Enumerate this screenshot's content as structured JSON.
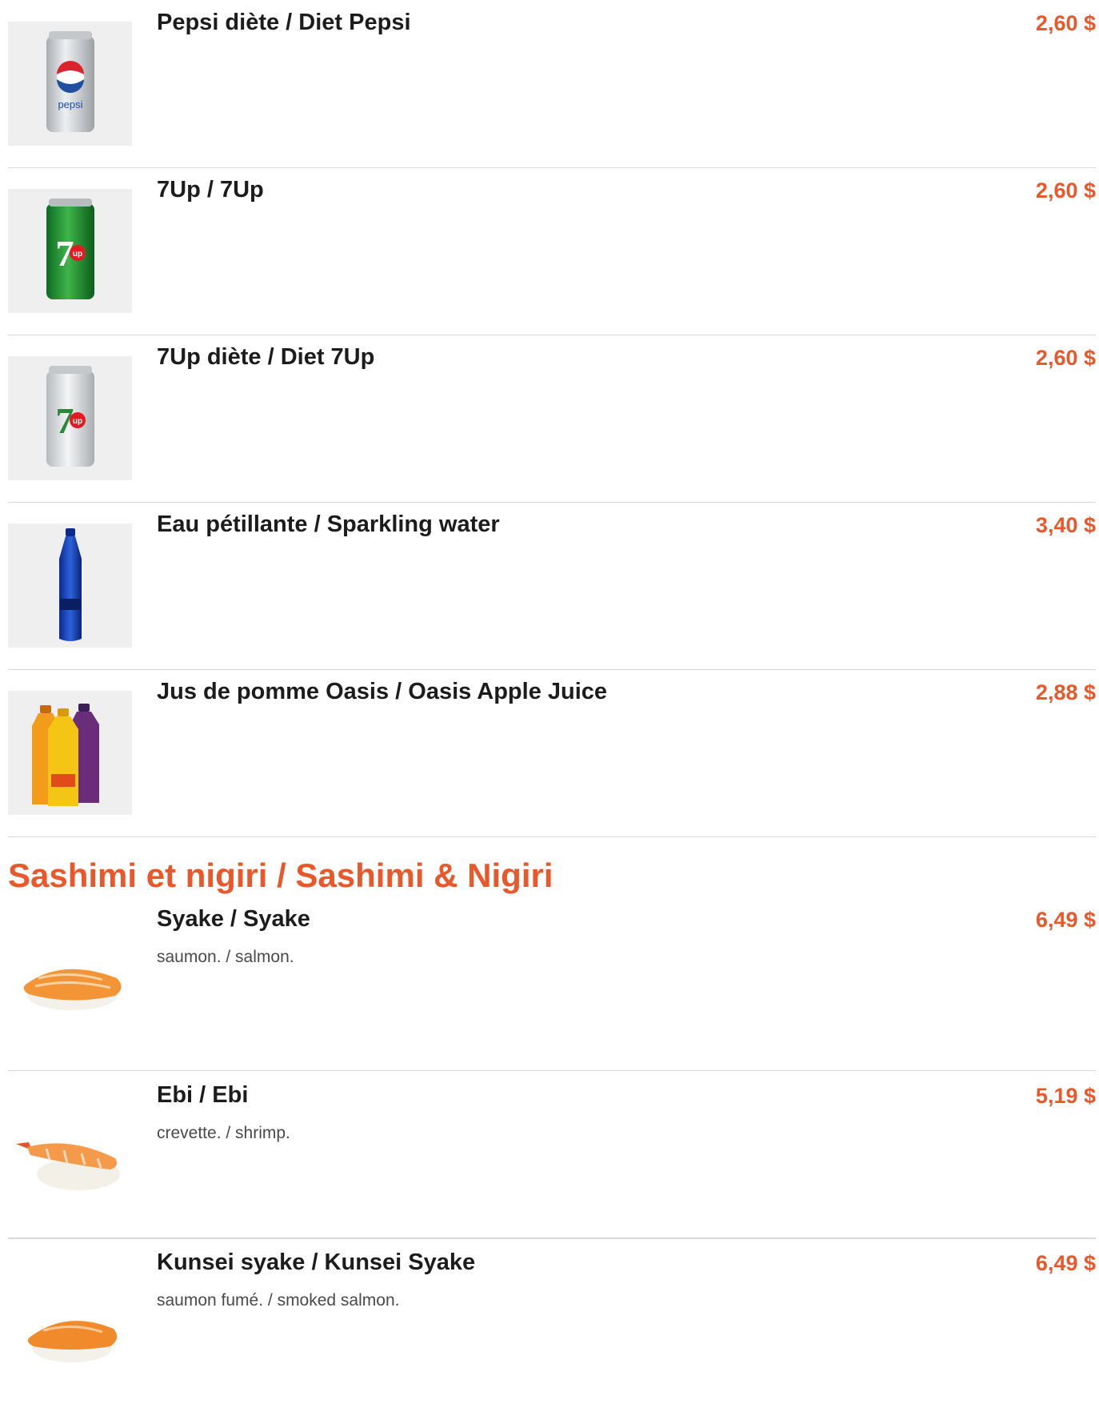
{
  "accent_color": "#e8582a",
  "drinks": [
    {
      "name": "Pepsi diète / Diet Pepsi",
      "price": "2,60 $",
      "icon": "diet-pepsi-can-icon"
    },
    {
      "name": "7Up / 7Up",
      "price": "2,60 $",
      "icon": "7up-can-icon"
    },
    {
      "name": "7Up diète / Diet 7Up",
      "price": "2,60 $",
      "icon": "diet-7up-can-icon"
    },
    {
      "name": "Eau pétillante / Sparkling water",
      "price": "3,40 $",
      "icon": "sparkling-water-bottle-icon"
    },
    {
      "name": "Jus de pomme Oasis / Oasis Apple Juice",
      "price": "2,88 $",
      "icon": "oasis-juice-bottles-icon"
    }
  ],
  "section": {
    "title": "Sashimi et nigiri / Sashimi & Nigiri"
  },
  "nigiri": [
    {
      "name": "Syake / Syake",
      "price": "6,49 $",
      "description": "saumon. / salmon.",
      "icon": "salmon-nigiri-icon"
    },
    {
      "name": "Ebi / Ebi",
      "price": "5,19 $",
      "description": "crevette. / shrimp.",
      "icon": "shrimp-nigiri-icon"
    },
    {
      "name": "Kunsei syake / Kunsei Syake",
      "price": "6,49 $",
      "description": "saumon fumé. / smoked salmon.",
      "icon": "smoked-salmon-nigiri-icon"
    }
  ]
}
